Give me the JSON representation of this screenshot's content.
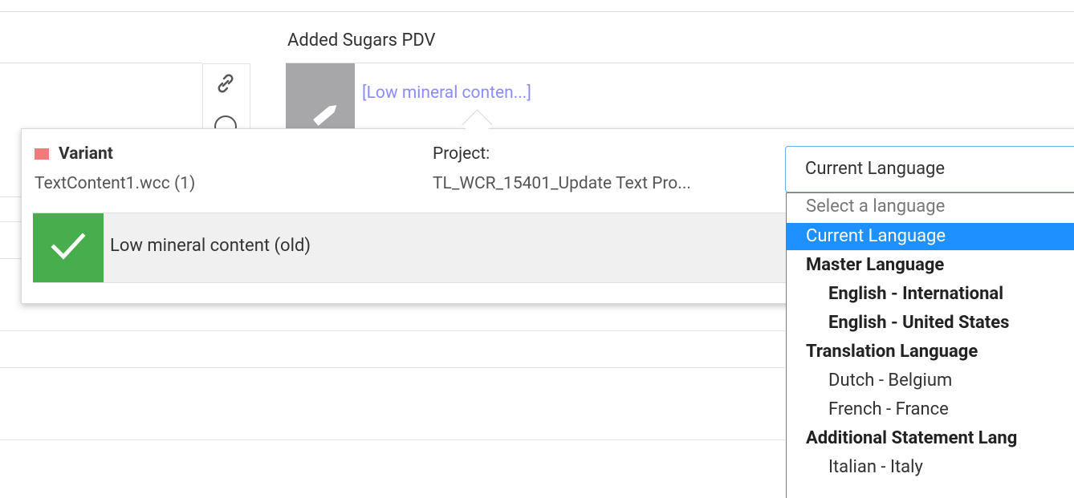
{
  "column": {
    "title": "Added Sugars PDV"
  },
  "preview": {
    "link_text": "[Low mineral conten...]"
  },
  "popup": {
    "variant_label": "Variant",
    "variant_file": "TextContent1.wcc (1)",
    "project_label": "Project:",
    "project_value": "TL_WCR_15401_Update Text Pro...",
    "row_text": "Low mineral content (old)"
  },
  "colors": {
    "variant_swatch": "#f07b7b",
    "check_green": "#48ad4c",
    "selected": "#1e90ff",
    "link": "#8c8cff"
  },
  "language_select": {
    "selected_value": "Current Language",
    "options": [
      {
        "label": "Select a language"
      },
      {
        "label": "Current Language"
      },
      {
        "label": "Master Language"
      },
      {
        "label": "English - International"
      },
      {
        "label": "English - United States"
      },
      {
        "label": "Translation Language"
      },
      {
        "label": "Dutch - Belgium"
      },
      {
        "label": "French - France"
      },
      {
        "label": "Additional Statement Lang"
      },
      {
        "label": "Italian - Italy"
      }
    ]
  }
}
